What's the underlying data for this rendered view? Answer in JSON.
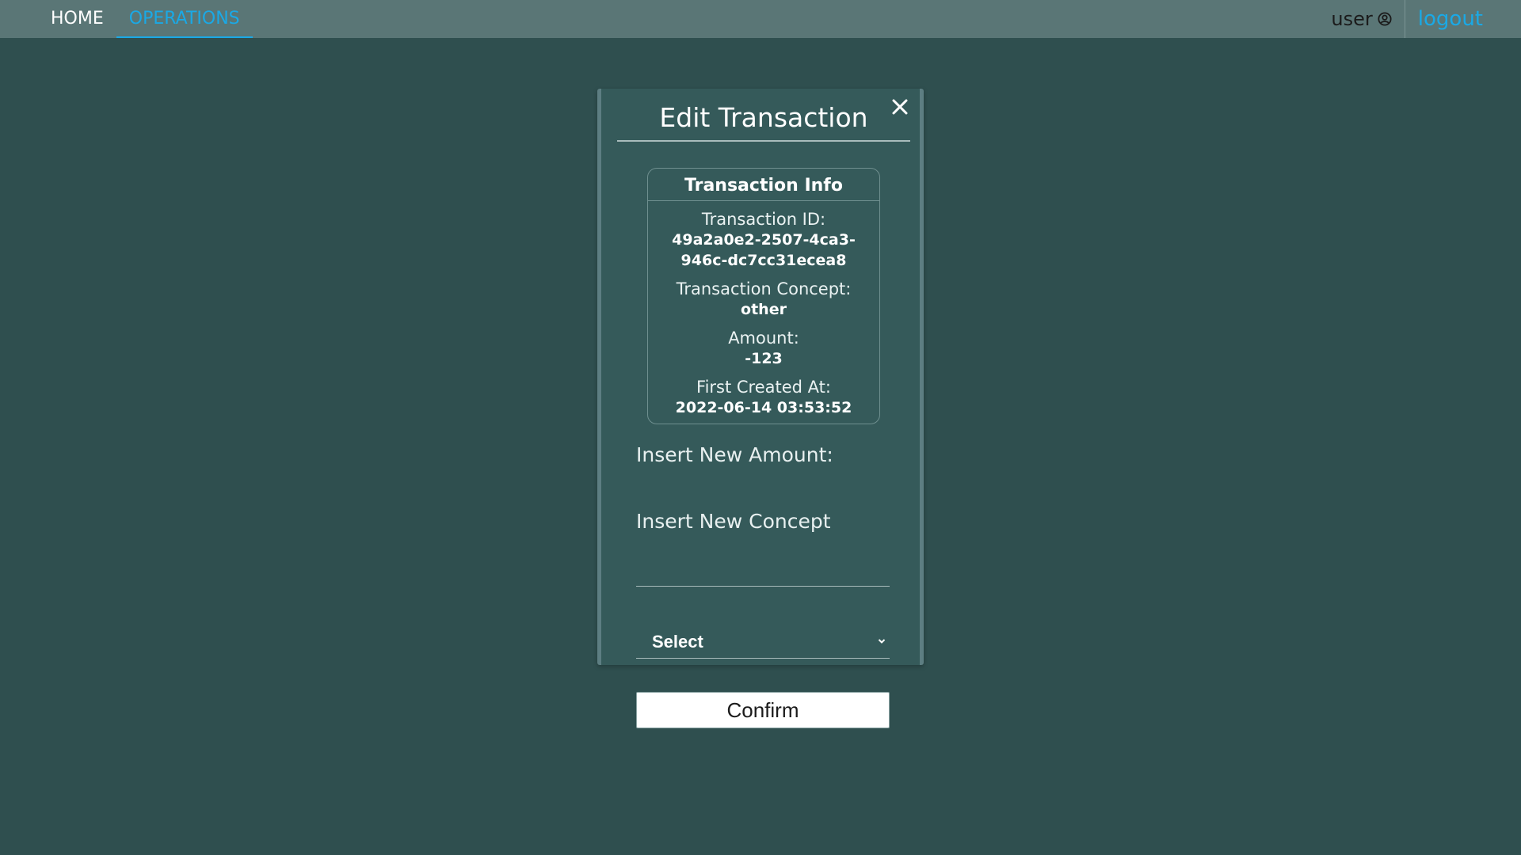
{
  "nav": {
    "home_label": "HOME",
    "operations_label": "OPERATIONS",
    "active_tab": "OPERATIONS",
    "user_label": "user",
    "logout_label": "logout"
  },
  "modal": {
    "title": "Edit Transaction",
    "info": {
      "title": "Transaction Info",
      "id_label": "Transaction ID:",
      "id_value": "49a2a0e2-2507-4ca3-946c-dc7cc31ecea8",
      "concept_label": "Transaction Concept:",
      "concept_value": "other",
      "amount_label": "Amount:",
      "amount_value": "-123",
      "created_label": "First Created At:",
      "created_value": "2022-06-14 03:53:52"
    },
    "amount_field": {
      "label": "Insert New Amount:",
      "value": ""
    },
    "concept_field": {
      "label": "Insert New Concept",
      "selected": "Select"
    },
    "confirm_label": "Confirm"
  },
  "icons": {
    "user": "user-circle-icon",
    "close": "close-icon",
    "chevron": "chevron-down-icon"
  },
  "colors": {
    "background": "#2f4f4f",
    "navbar": "#5a7676",
    "accent": "#1aa9e6",
    "modal": "#355a5a"
  }
}
